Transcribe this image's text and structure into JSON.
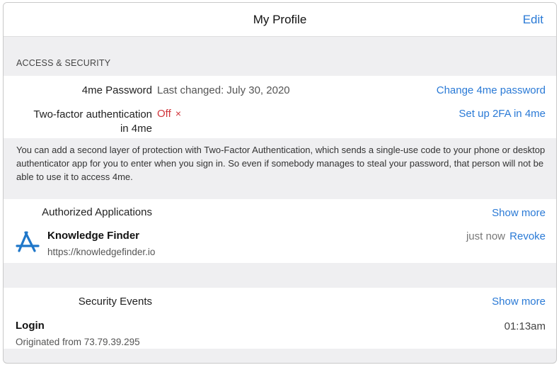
{
  "header": {
    "title": "My Profile",
    "edit_label": "Edit"
  },
  "access_security": {
    "section_title": "ACCESS & SECURITY",
    "password": {
      "label": "4me Password",
      "value": "Last changed: July 30, 2020",
      "action": "Change 4me password"
    },
    "two_factor": {
      "label_line1": "Two-factor authentication",
      "label_line2": "in 4me",
      "status": "Off",
      "status_icon": "×",
      "action": "Set up 2FA in 4me"
    },
    "description": "You can add a second layer of protection with Two-Factor Authentication, which sends a single-use code to your phone or desktop authenticator app for you to enter when you sign in. So even if somebody manages to steal your password, that person will not be able to use it to access 4me."
  },
  "authorized_apps": {
    "title": "Authorized Applications",
    "show_more": "Show more",
    "items": [
      {
        "icon": "app-store-icon",
        "name": "Knowledge Finder",
        "url": "https://knowledgefinder.io",
        "time": "just now",
        "action": "Revoke"
      }
    ]
  },
  "security_events": {
    "title": "Security Events",
    "show_more": "Show more",
    "items": [
      {
        "name": "Login",
        "detail": "Originated from 73.79.39.295",
        "time": "01:13am"
      }
    ]
  },
  "colors": {
    "accent": "#2a7ad6",
    "danger": "#d0343a",
    "background": "#efeff1"
  }
}
